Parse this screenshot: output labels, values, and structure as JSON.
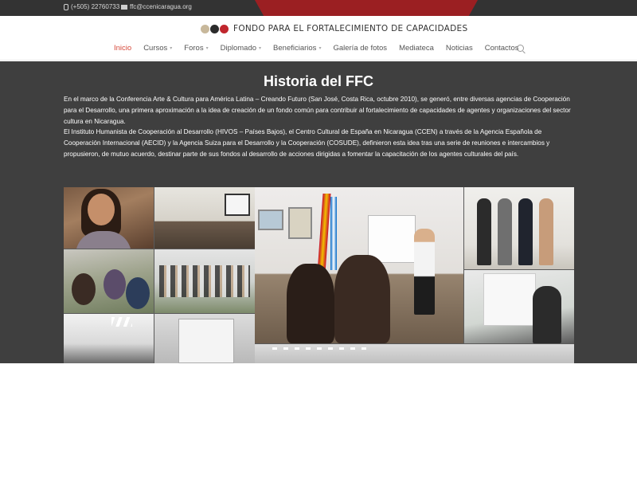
{
  "topbar": {
    "phone": "(+505) 22760733",
    "email": "ffc@ccenicaragua.org",
    "phone_icon": "phone-icon",
    "email_icon": "mail-icon"
  },
  "header": {
    "logo_text": "FONDO PARA EL FORTALECIMIENTO DE CAPACIDADES",
    "logo_colors": [
      "#c8b89b",
      "#2b2b2b",
      "#c0262d"
    ]
  },
  "nav": {
    "items": [
      {
        "label": "Inicio",
        "active": true,
        "has_caret": false
      },
      {
        "label": "Cursos",
        "active": false,
        "has_caret": true
      },
      {
        "label": "Foros",
        "active": false,
        "has_caret": true
      },
      {
        "label": "Diplomado",
        "active": false,
        "has_caret": true
      },
      {
        "label": "Beneficiarios",
        "active": false,
        "has_caret": true
      },
      {
        "label": "Galería de fotos",
        "active": false,
        "has_caret": false
      },
      {
        "label": "Mediateca",
        "active": false,
        "has_caret": false
      },
      {
        "label": "Noticias",
        "active": false,
        "has_caret": false
      },
      {
        "label": "Contactos",
        "active": false,
        "has_caret": false
      }
    ],
    "caret_glyph": "▾",
    "search_icon": "search-icon",
    "active_color": "#d64a3b"
  },
  "main": {
    "title": "Historia del FFC",
    "paragraph1": "En el marco de la Conferencia Arte & Cultura para América Latina – Creando Futuro (San José, Costa Rica, octubre 2010), se generó, entre diversas agencias de Cooperación para el Desarrollo, una primera aproximación a la idea de creación de un fondo común para contribuir al fortalecimiento de capacidades de agentes y organizaciones del sector cultura en Nicaragua.",
    "paragraph2": "El Instituto Humanista de Cooperación al Desarrollo (HIVOS – Países Bajos), el Centro Cultural de España en Nicaragua (CCEN) a través de la Agencia Española de Cooperación Internacional (AECID) y la Agencia Suiza para el Desarrollo y la Cooperación (COSUDE), definieron esta idea tras una serie de reuniones e intercambios y propusieron, de mutuo acuerdo, destinar parte de sus fondos al desarrollo de acciones dirigidas a fomentar la capacitación de los agentes culturales del país.",
    "background": "#3f3f3f"
  }
}
